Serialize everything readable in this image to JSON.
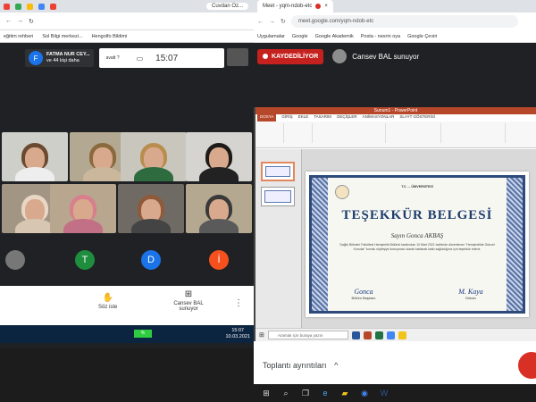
{
  "left_browser": {
    "user_chip": "Cuvdan Oz...",
    "bookmarks": [
      "eğitim rehberi",
      "Sol Bilgi merkezi...",
      "Hengolfo Bildimi"
    ]
  },
  "meet_left": {
    "presenter_initial": "F",
    "presenter_name": "FATMA NUR CEY...",
    "presenter_sub": "ve 44 kişi daha",
    "card_small": "avatt ?",
    "card_clock": "15:07",
    "avatars": [
      {
        "letter": "T",
        "color": "#1e8e3e"
      },
      {
        "letter": "D",
        "color": "#1a73e8"
      },
      {
        "letter": "İ",
        "color": "#f4511e"
      }
    ],
    "controls": {
      "raise_hand_label": "Söz iste",
      "present_label": "Cansev BAL sunuyor"
    }
  },
  "left_taskbar": {
    "time": "15:07",
    "date": "10.03.2021",
    "battery": "%"
  },
  "right_browser": {
    "tab_title": "Meet - yqm-ndob-etc",
    "url": "meet.google.com/yqm-ndob-etc",
    "bookmarks": [
      "Uygulamalar",
      "Google",
      "Google Akademik",
      "Posta - nesrin oya",
      "Google Çeviri"
    ]
  },
  "meet_right": {
    "recording_label": "KAYDEDİLİYOR",
    "presenter_text": "Cansev BAL sunuyor",
    "meeting_details": "Toplantı ayrıntıları",
    "chevron": "^"
  },
  "powerpoint": {
    "title_bar": "Sunum1 - PowerPoint",
    "tabs": [
      "DOSYA",
      "GİRİŞ",
      "EKLE",
      "TASARIM",
      "GEÇİŞLER",
      "ANİMASYONLAR",
      "SLAYT GÖSTERİSİ"
    ],
    "search_placeholder": "Aramak için buraya yazın"
  },
  "certificate": {
    "institution": "T.C. ... ÜNİVERSİTESİ",
    "title": "TEŞEKKÜR BELGESİ",
    "recipient": "Sayın Gonca AKBAŞ",
    "paragraph": "Sağlık Bilimleri Fakültesi Hemşirelik Bölümü tarafından 10 Mart 2021 tarihinde düzenlenen \"Hemşirelikte Güncel Konular\" konulu söyleşiye konuşmacı olarak katılarak katkı sağladığınız için teşekkür ederiz.",
    "signatures": [
      {
        "role": "Bölüm Başkanı",
        "scribble": "Gonca"
      },
      {
        "role": "Dekan",
        "scribble": "M. Kaya"
      }
    ]
  }
}
